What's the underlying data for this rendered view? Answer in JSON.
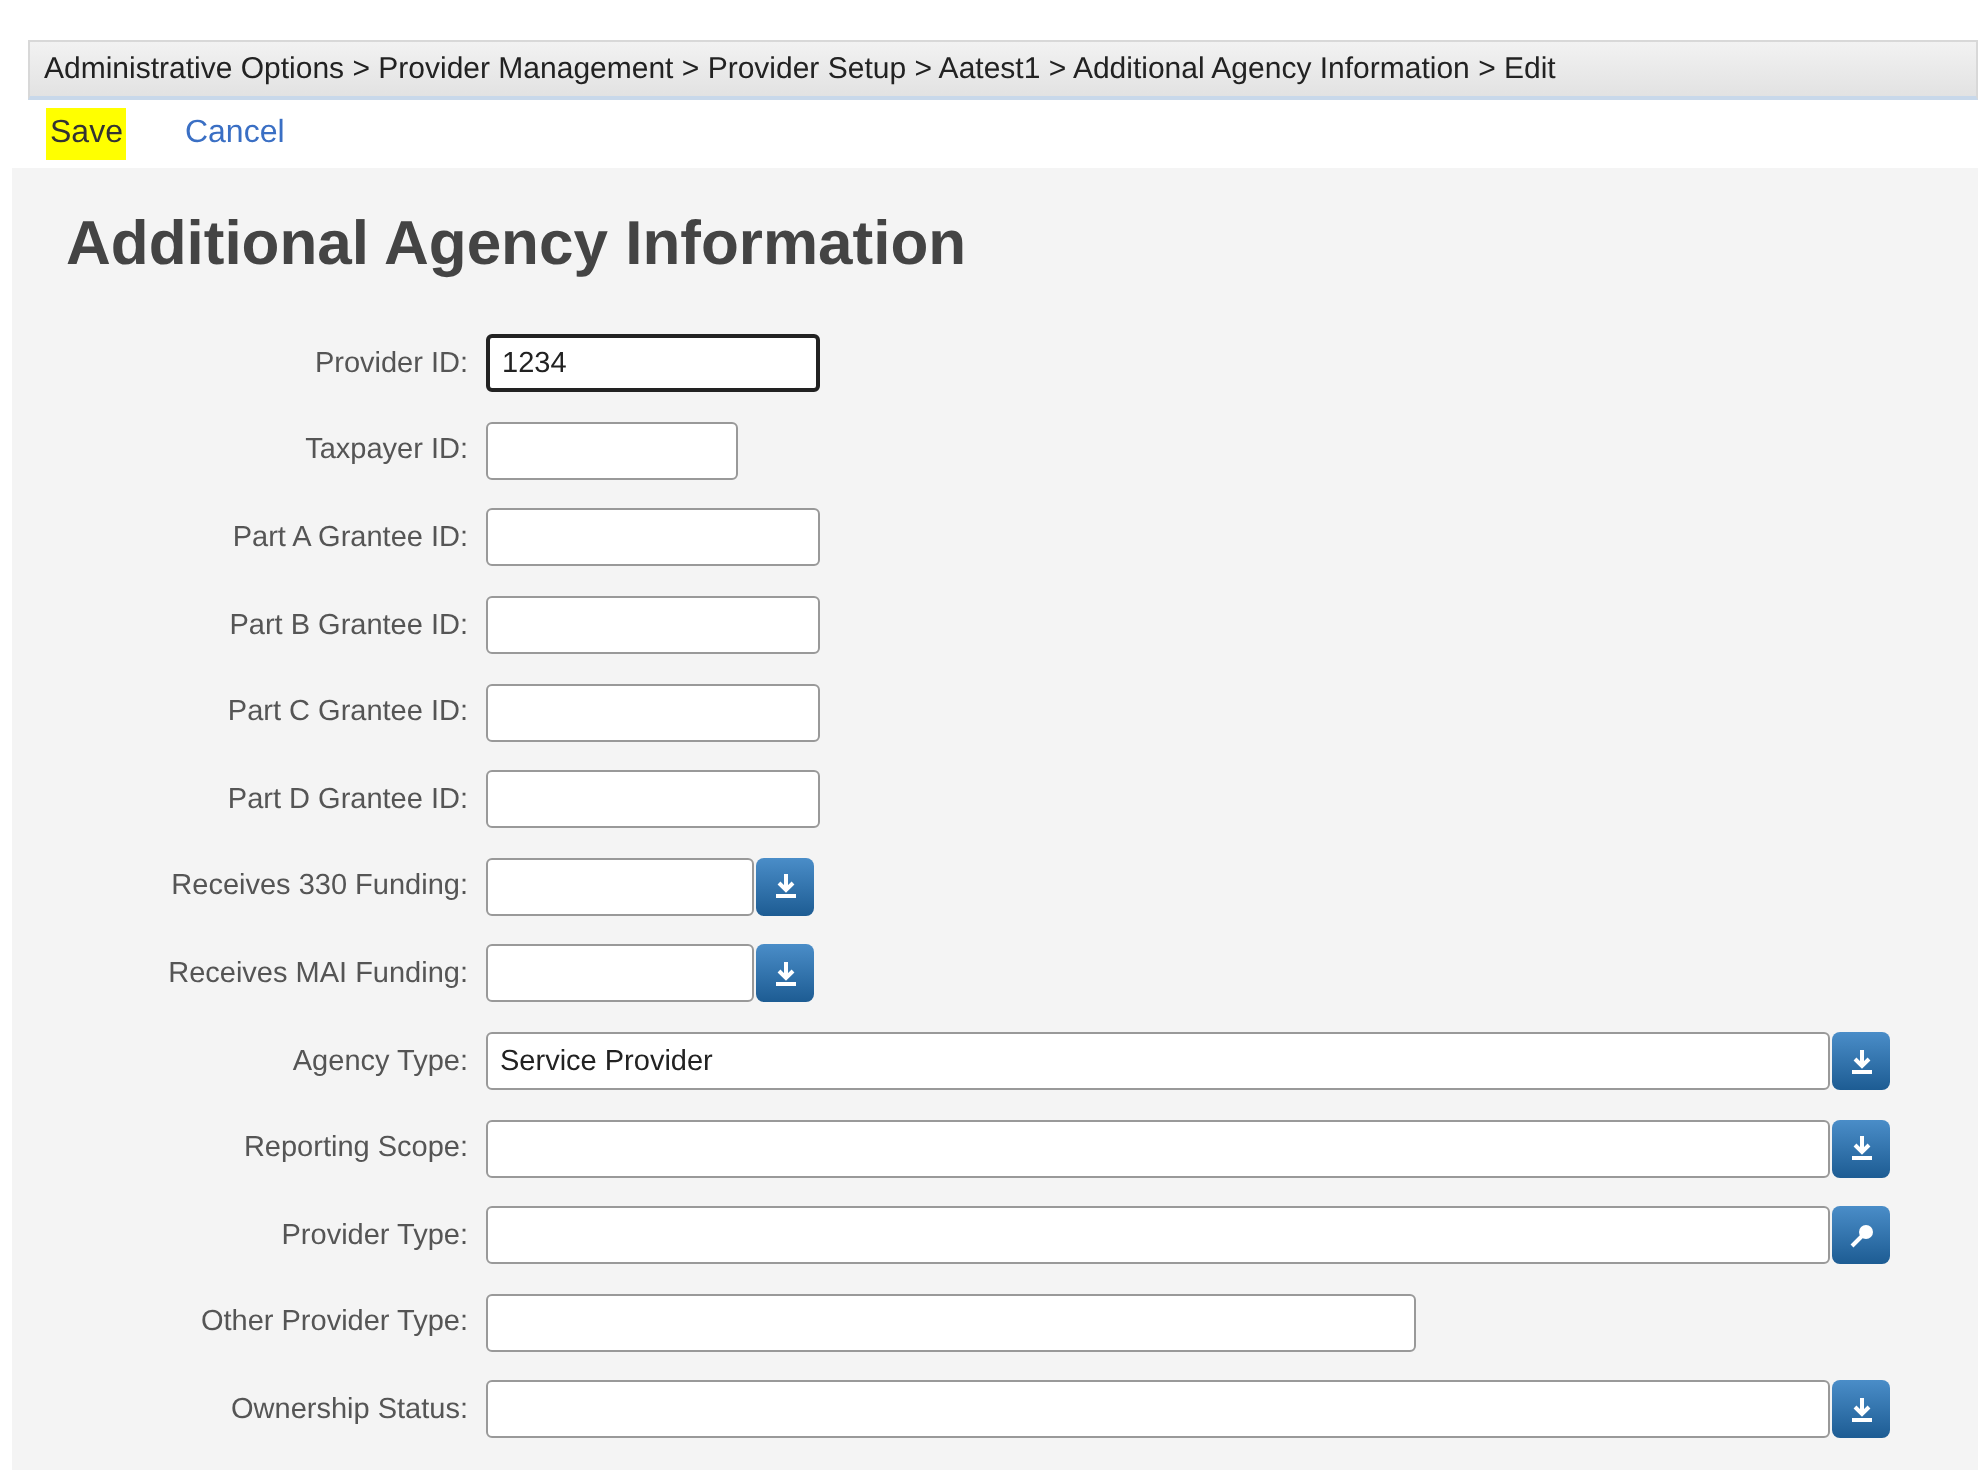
{
  "breadcrumb": "Administrative Options > Provider Management > Provider Setup > Aatest1 > Additional Agency Information > Edit",
  "actions": [
    {
      "label": "Save",
      "highlighted": true
    },
    {
      "label": "Cancel",
      "highlighted": false
    }
  ],
  "heading": "Additional Agency Information",
  "fields": [
    {
      "label": "Provider ID:",
      "kind": "text",
      "value": "1234",
      "focused": true
    },
    {
      "label": "Taxpayer ID:",
      "kind": "text",
      "focused": false
    },
    {
      "label": "Part A Grantee ID:",
      "kind": "text",
      "focused": false
    },
    {
      "label": "Part B Grantee ID:",
      "kind": "text",
      "focused": false
    },
    {
      "label": "Part C Grantee ID:",
      "kind": "text",
      "focused": false
    },
    {
      "label": "Part D Grantee ID:",
      "kind": "text",
      "focused": false
    },
    {
      "label": "Receives 330 Funding:",
      "kind": "select",
      "focused": false
    },
    {
      "label": "Receives MAI Funding:",
      "kind": "select",
      "focused": false
    },
    {
      "label": "Agency Type:",
      "kind": "select",
      "value": "Service Provider",
      "focused": false
    },
    {
      "label": "Reporting Scope:",
      "kind": "select",
      "focused": false
    },
    {
      "label": "Provider Type:",
      "kind": "lookup",
      "focused": false
    },
    {
      "label": "Other Provider Type:",
      "kind": "text",
      "focused": false
    },
    {
      "label": "Ownership Status:",
      "kind": "select",
      "focused": false
    }
  ]
}
